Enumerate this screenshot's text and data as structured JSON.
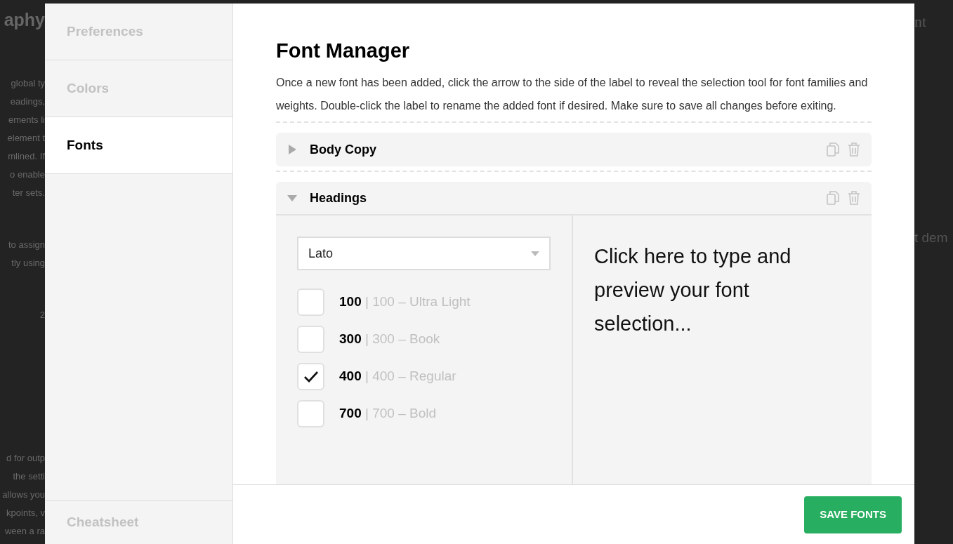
{
  "background": {
    "title": "aphy",
    "left_groups": [
      [
        "global ty",
        "eadings, ",
        "ements li",
        "element t",
        "mlined. If",
        "o enable",
        "ter sets."
      ],
      [
        "to assign",
        "tly using"
      ],
      [
        "2"
      ],
      [
        "d for outp",
        " the setti",
        "allows you",
        "kpoints, v",
        "ween a ra"
      ]
    ],
    "right_texts": [
      "nt",
      "t dem"
    ]
  },
  "sidebar": {
    "items": [
      {
        "label": "Preferences",
        "selected": false
      },
      {
        "label": "Colors",
        "selected": false
      },
      {
        "label": "Fonts",
        "selected": true
      }
    ],
    "footer_item": "Cheatsheet"
  },
  "main": {
    "title": "Font Manager",
    "description": "Once a new font has been added, click the arrow to the side of the label to reveal the selection tool for font families and weights. Double-click the label to rename the added font if desired. Make sure to save all changes before exiting.",
    "fonts": [
      {
        "name": "Body Copy",
        "expanded": false
      },
      {
        "name": "Headings",
        "expanded": true,
        "family": "Lato",
        "preview": "Click here to type and preview your font selection...",
        "weights": [
          {
            "label": "**100** | 100 – Ultra Light",
            "checked": false
          },
          {
            "label": "**300** | 300 – Book",
            "checked": false
          },
          {
            "label": "**400** | 400 – Regular",
            "checked": true
          },
          {
            "label": "**700** | 700 – Bold",
            "checked": false
          }
        ]
      }
    ]
  },
  "footer": {
    "button": "SAVE FONTS"
  }
}
